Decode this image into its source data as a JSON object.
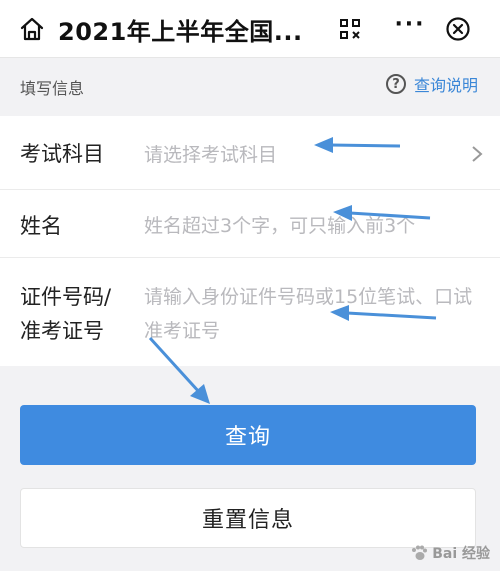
{
  "header": {
    "title": "2021年上半年全国...",
    "icons": [
      "home-icon",
      "scan-icon",
      "more-icon",
      "close-icon"
    ]
  },
  "section": {
    "label": "填写信息",
    "help_link": "查询说明",
    "help_icon": "question-circle-icon"
  },
  "form": {
    "fields": [
      {
        "label": "考试科目",
        "placeholder": "请选择考试科目"
      },
      {
        "label": "姓名",
        "placeholder": "姓名超过3个字，可只输入前3个"
      },
      {
        "label": "证件号码/\n准考证号",
        "placeholder": "请输入身份证件号码或15位笔试、口试准考证号"
      }
    ]
  },
  "buttons": {
    "query": "查询",
    "reset": "重置信息"
  },
  "watermark": {
    "text": "Bai 经验"
  },
  "colors": {
    "accent": "#3f8be0",
    "link": "#3b87d7",
    "arrow": "#4a90d9"
  }
}
